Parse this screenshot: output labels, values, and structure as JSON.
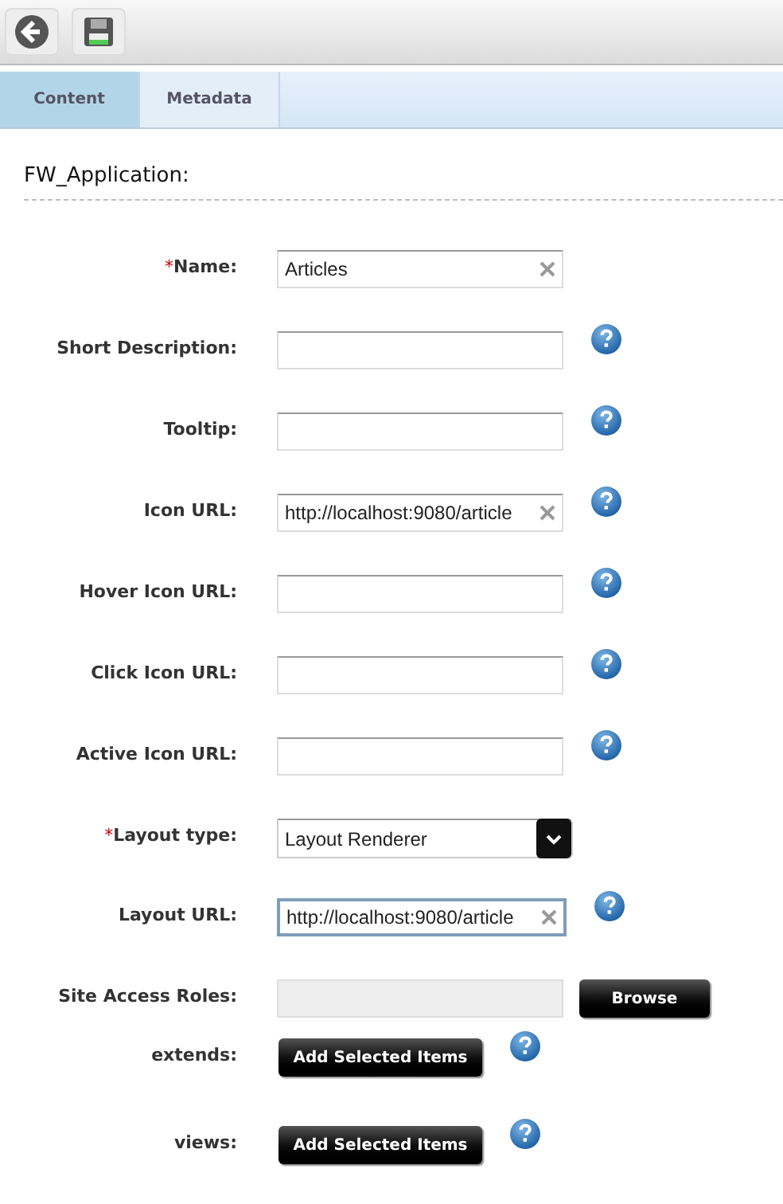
{
  "tabs": [
    {
      "label": "Content",
      "selected": true
    },
    {
      "label": "Metadata",
      "selected": false
    }
  ],
  "form": {
    "title": "FW_Application:",
    "required_mark": "*",
    "fields": [
      {
        "kind": "text",
        "label": "Name:",
        "required": true,
        "value": "Articles",
        "clearable": true,
        "help": false,
        "focused": false
      },
      {
        "kind": "text",
        "label": "Short Description:",
        "required": false,
        "clearable": false,
        "help": true,
        "focused": false
      },
      {
        "kind": "text",
        "label": "Tooltip:",
        "required": false,
        "clearable": false,
        "help": true,
        "focused": false
      },
      {
        "kind": "text",
        "label": "Icon URL:",
        "required": false,
        "value": "http://localhost:9080/article",
        "clearable": true,
        "help": true,
        "focused": false
      },
      {
        "kind": "text",
        "label": "Hover Icon URL:",
        "required": false,
        "clearable": false,
        "help": true,
        "focused": false
      },
      {
        "kind": "text",
        "label": "Click Icon URL:",
        "required": false,
        "clearable": false,
        "help": true,
        "focused": false
      },
      {
        "kind": "text",
        "label": "Active Icon URL:",
        "required": false,
        "clearable": false,
        "help": true,
        "focused": false
      },
      {
        "kind": "select",
        "label": "Layout type:",
        "required": true,
        "value": "Layout Renderer",
        "help": false
      },
      {
        "kind": "text",
        "label": "Layout URL:",
        "required": false,
        "value": "http://localhost:9080/article",
        "clearable": true,
        "help": true,
        "focused": true
      },
      {
        "kind": "browse",
        "label": "Site Access Roles:",
        "required": false,
        "button": "Browse",
        "help": false
      },
      {
        "kind": "multi",
        "label": "extends:",
        "required": false,
        "button": "Add Selected Items",
        "help": true
      },
      {
        "kind": "multi",
        "label": "views:",
        "required": false,
        "button": "Add Selected Items",
        "help": true
      }
    ]
  }
}
